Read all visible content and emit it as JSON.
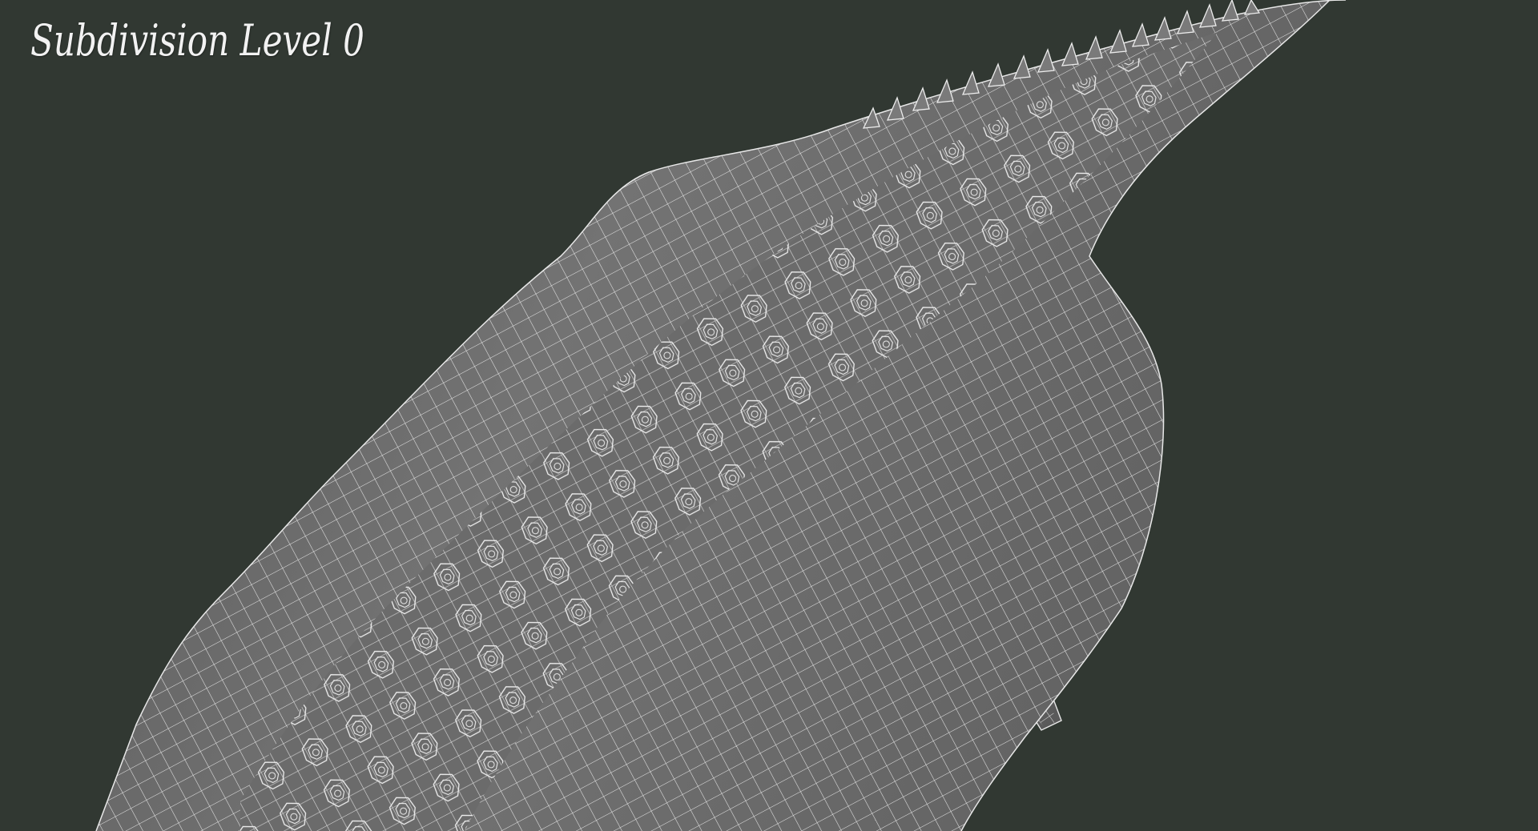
{
  "viewport": {
    "overlay_label": "Subdivision Level 0"
  },
  "colors": {
    "background": "#313832",
    "mesh_fill": "#6f6f6f",
    "mesh_shadow": "#4a4a4a",
    "wire": "#e8e8e8",
    "label": "#f2f2f2"
  },
  "scene": {
    "subject": "crocodile-wireframe-mesh",
    "view": "top-down-back-and-left-foreleg"
  }
}
